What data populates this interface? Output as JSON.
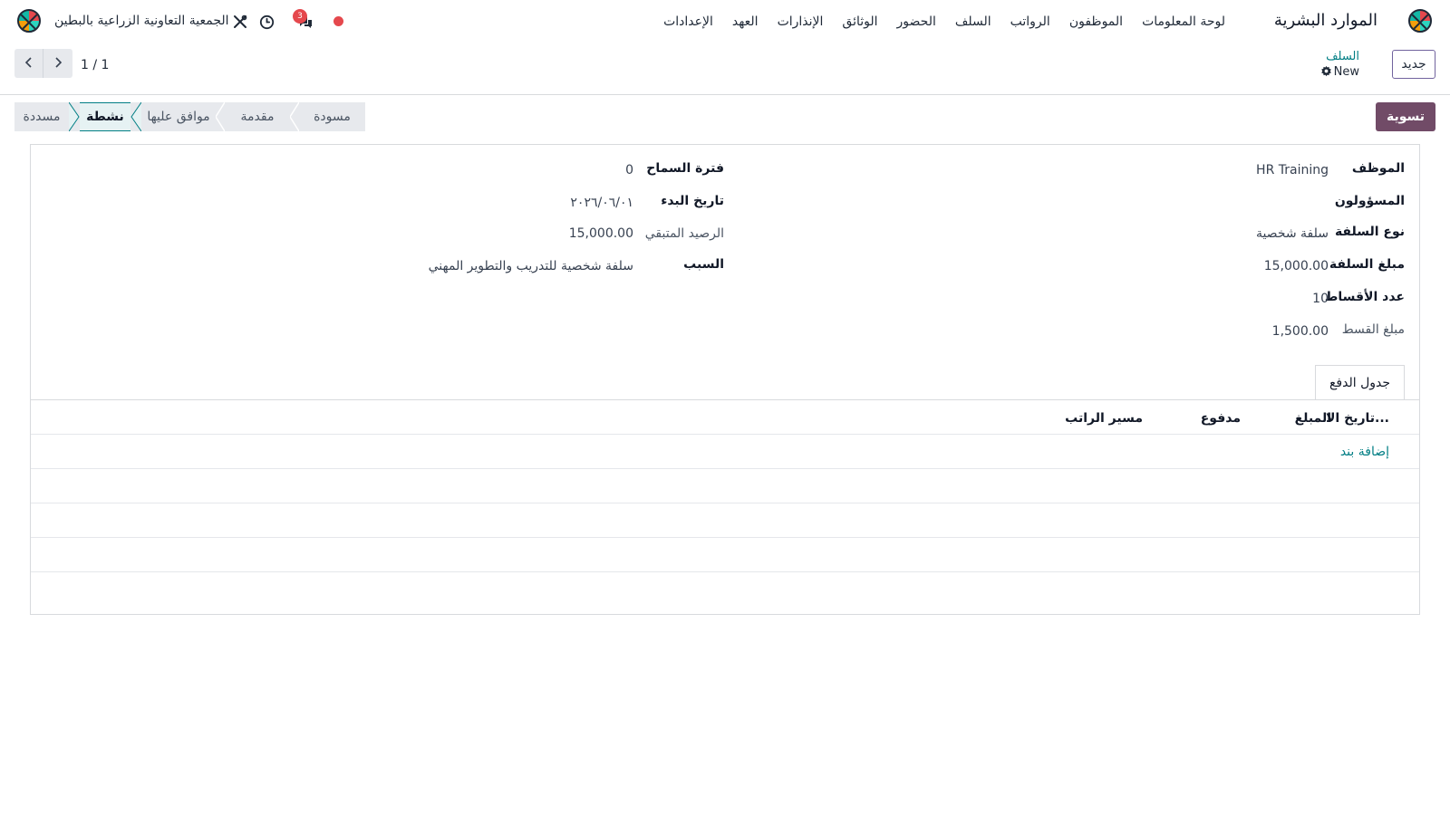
{
  "topbar": {
    "app_name": "الموارد البشرية",
    "menu": [
      "لوحة المعلومات",
      "الموظفون",
      "الرواتب",
      "السلف",
      "الحضور",
      "الوثائق",
      "الإنذارات",
      "العهد",
      "الإعدادات"
    ],
    "company": "الجمعية التعاونية الزراعية بالبطين",
    "chat_badge": "3",
    "icons": [
      "app-logo-icon",
      "chat-icon",
      "clock-icon",
      "tools-icon",
      "recording-dot-icon"
    ]
  },
  "control": {
    "new_label": "جديد",
    "breadcrumb_parent": "السلف",
    "breadcrumb_current": "New",
    "pager": "1 / 1"
  },
  "status": {
    "settle_label": "تسوية",
    "stages": [
      "مسودة",
      "مقدمة",
      "موافق عليها",
      "نشطة",
      "مسددة"
    ],
    "active_stage": "نشطة"
  },
  "form": {
    "employee_label": "الموظف",
    "employee_value": "HR Training",
    "managers_label": "المسؤولون",
    "managers_value": "",
    "loan_type_label": "نوع السلفة",
    "loan_type_value": "سلفة شخصية",
    "loan_amount_label": "مبلغ السلفة",
    "loan_amount_value": "15,000.00",
    "installments_label": "عدد الأقساط",
    "installments_value": "10",
    "installment_amount_label": "مبلغ القسط",
    "installment_amount_value": "1,500.00",
    "grace_label": "فترة السماح",
    "grace_value": "0",
    "start_date_label": "تاريخ البدء",
    "start_date_value": "٢٠٢٦/٠٦/٠١",
    "balance_label": "الرصيد المتبقي",
    "balance_value": "15,000.00",
    "reason_label": "السبب",
    "reason_value": "سلفة شخصية للتدريب والتطوير المهني"
  },
  "tabs": {
    "payment_schedule": "جدول الدفع"
  },
  "table": {
    "columns": [
      "تاريخ الا...",
      "المبلغ",
      "مدفوع",
      "مسير الراتب"
    ],
    "add_line": "إضافة بند",
    "rows": []
  }
}
